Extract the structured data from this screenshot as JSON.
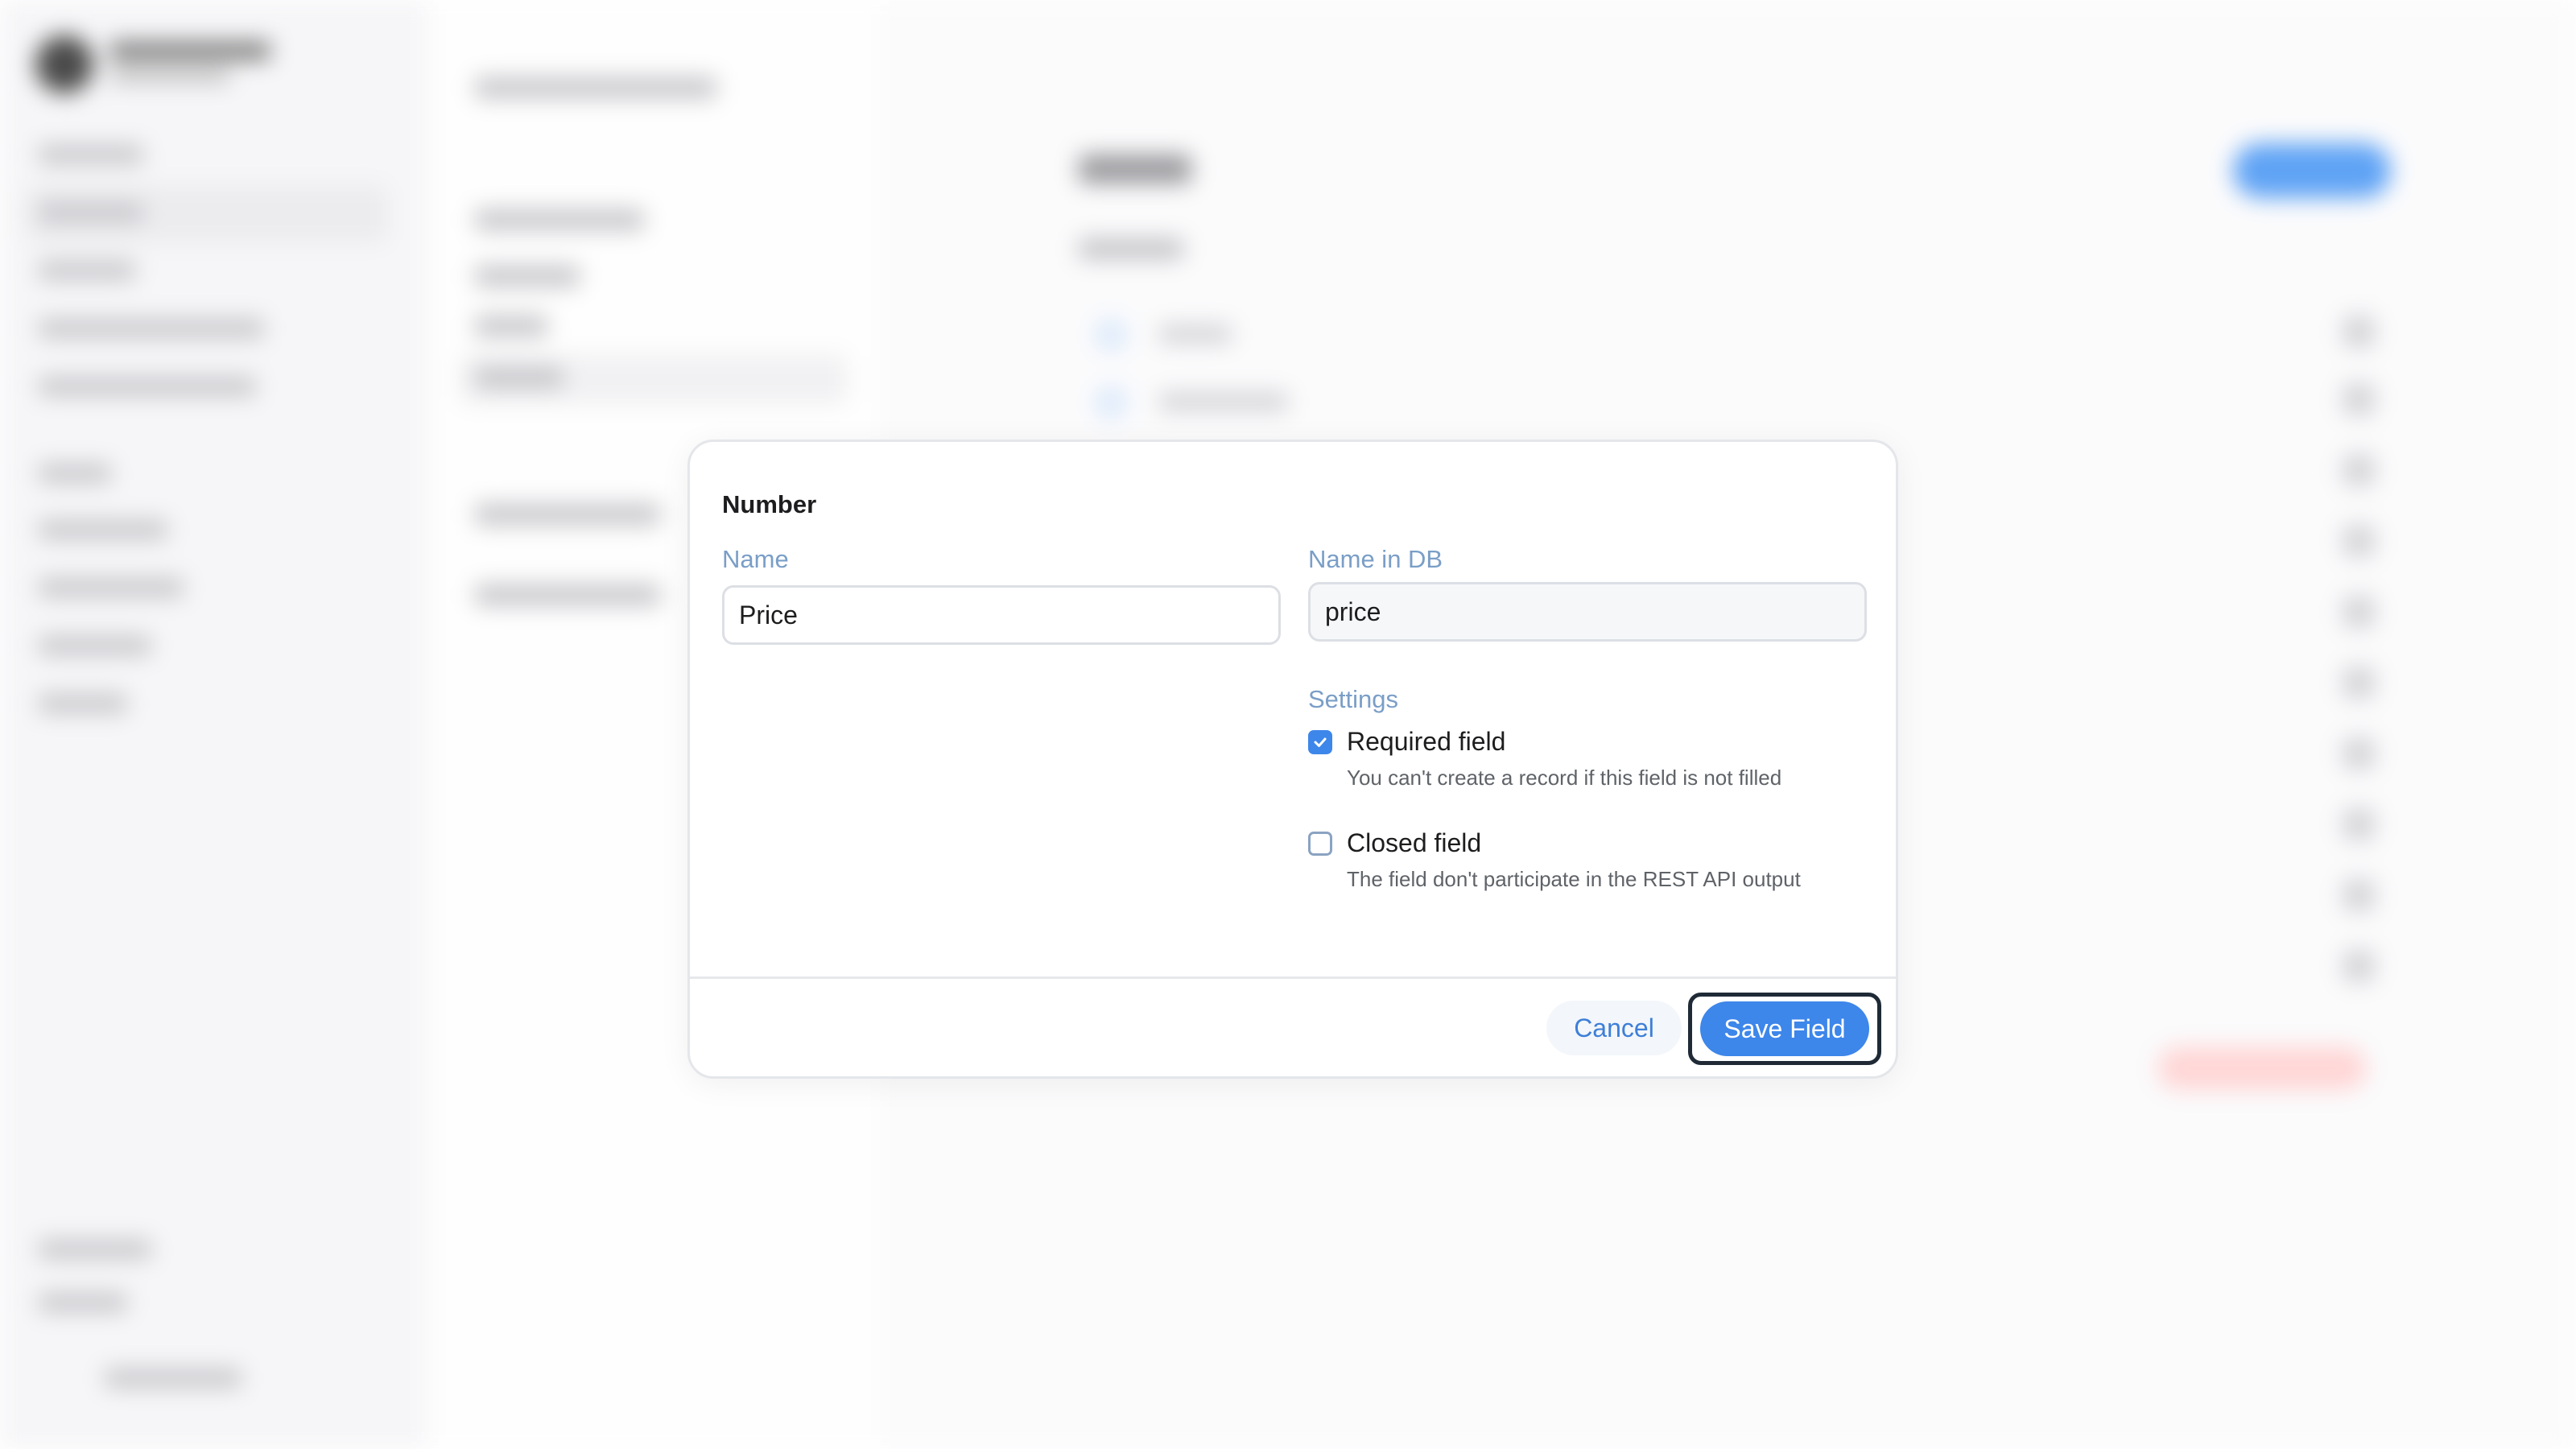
{
  "modal": {
    "title": "Number",
    "name_label": "Name",
    "name_value": "Price",
    "db_name_label": "Name in DB",
    "db_name_value": "price",
    "settings_label": "Settings",
    "required": {
      "label": "Required field",
      "description": "You can't create a record if this field is not filled",
      "checked": true
    },
    "closed": {
      "label": "Closed field",
      "description": "The field don't participate in the REST API output",
      "checked": false
    },
    "cancel_label": "Cancel",
    "save_label": "Save Field"
  },
  "colors": {
    "accent": "#3d86ea",
    "label": "#7a9ec7",
    "focus_ring": "#1f2a36"
  }
}
